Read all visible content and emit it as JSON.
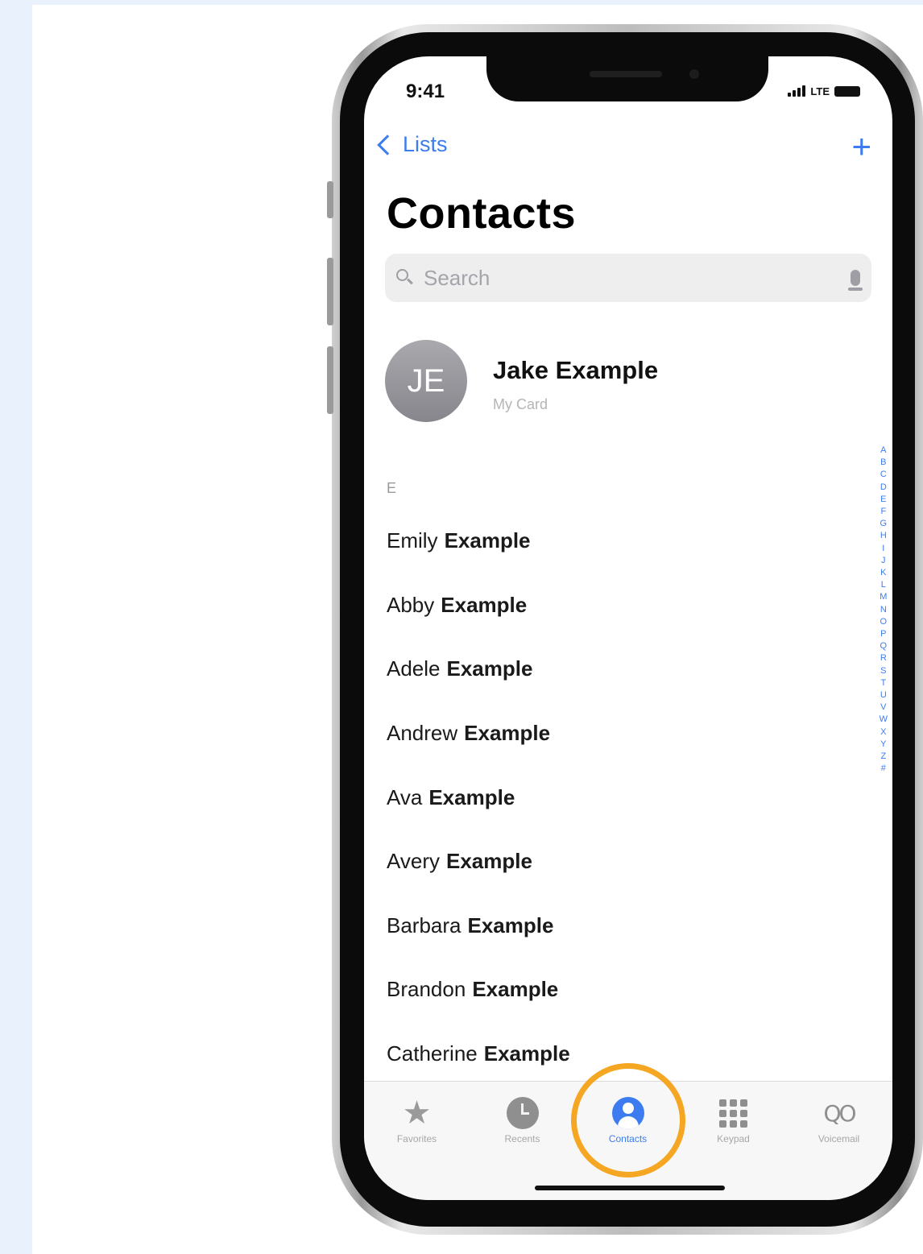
{
  "status": {
    "time": "9:41",
    "carrier": "LTE"
  },
  "nav": {
    "back_label": "Lists",
    "add_label": "+"
  },
  "title": "Contacts",
  "search": {
    "placeholder": "Search",
    "value": ""
  },
  "my_card": {
    "initials": "JE",
    "name": "Jake Example",
    "subtitle": "My Card"
  },
  "section_letter": "E",
  "contacts": [
    {
      "first": "Emily",
      "last": "Example"
    },
    {
      "first": "Abby",
      "last": "Example"
    },
    {
      "first": "Adele",
      "last": "Example"
    },
    {
      "first": "Andrew",
      "last": "Example"
    },
    {
      "first": "Ava",
      "last": "Example"
    },
    {
      "first": "Avery",
      "last": "Example"
    },
    {
      "first": "Barbara",
      "last": "Example"
    },
    {
      "first": "Brandon",
      "last": "Example"
    },
    {
      "first": "Catherine",
      "last": "Example"
    }
  ],
  "index_letters": [
    "A",
    "B",
    "C",
    "D",
    "E",
    "F",
    "G",
    "H",
    "I",
    "J",
    "K",
    "L",
    "M",
    "N",
    "O",
    "P",
    "Q",
    "R",
    "S",
    "T",
    "U",
    "V",
    "W",
    "X",
    "Y",
    "Z",
    "#"
  ],
  "tabs": [
    {
      "label": "Favorites",
      "icon": "star-icon"
    },
    {
      "label": "Recents",
      "icon": "clock-icon"
    },
    {
      "label": "Contacts",
      "icon": "person-icon"
    },
    {
      "label": "Keypad",
      "icon": "keypad-icon"
    },
    {
      "label": "Voicemail",
      "icon": "voicemail-icon"
    }
  ],
  "active_tab": "Contacts",
  "colors": {
    "accent": "#3d7cf0",
    "highlight": "#f5a623"
  }
}
